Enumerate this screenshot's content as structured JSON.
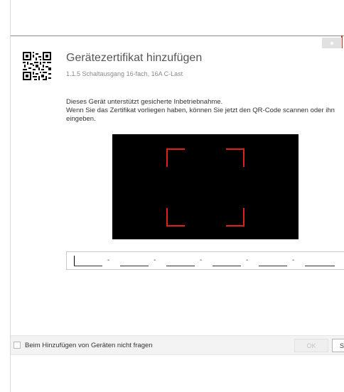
{
  "dialog": {
    "title": "Gerätezertifikat hinzufügen",
    "subtitle": "1.1.5 Schaltausgang 16-fach, 16A C-Last",
    "description_line1": "Dieses Gerät unterstützt gesicherte Inbetriebnahme.",
    "description_line2": "Wenn Sie das Zertifikat vorliegen haben, können Sie jetzt den QR-Code scannen oder ihn",
    "description_line3": "eingeben."
  },
  "certificate_input": {
    "segments": [
      "",
      "",
      "",
      "",
      "",
      ""
    ],
    "separator": "-"
  },
  "footer": {
    "checkbox_label": "Beim Hinzufügen von Geräten nicht fragen",
    "checkbox_checked": false,
    "ok_label": "OK",
    "next_label": "S"
  },
  "icons": {
    "close": "close-icon",
    "qr": "qr-code-icon"
  },
  "colors": {
    "scan_frame": "#e02020",
    "camera_background": "#000000",
    "footer_background": "#f3f3f3"
  }
}
